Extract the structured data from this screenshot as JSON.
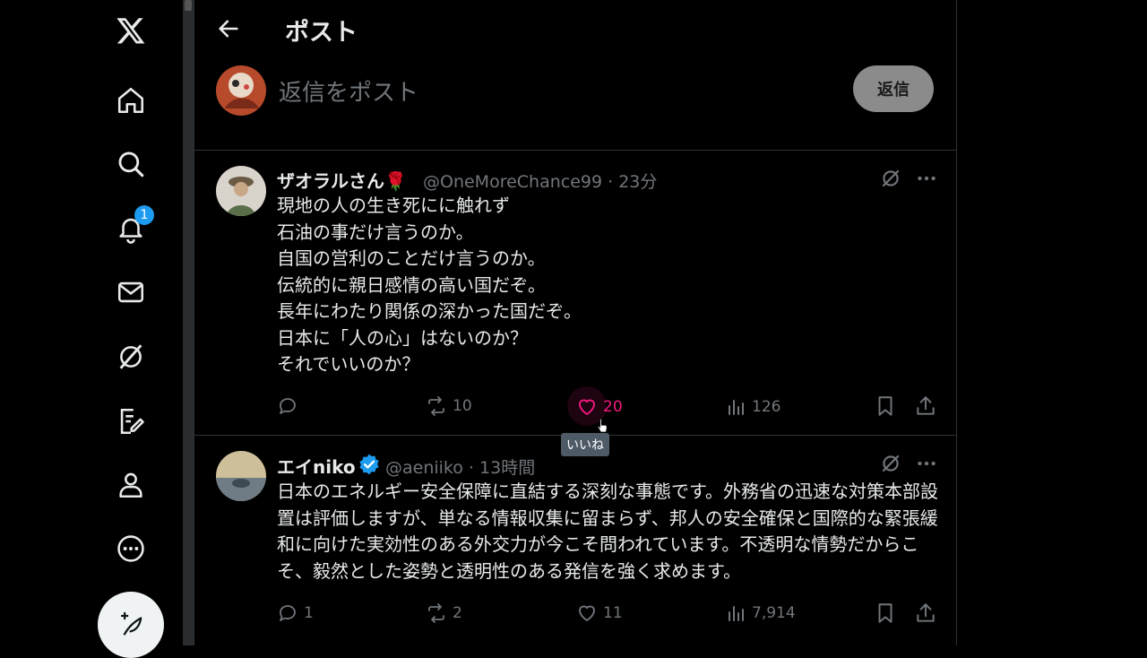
{
  "app": {
    "logo": "X"
  },
  "nav": {
    "items": [
      {
        "icon": "home-icon"
      },
      {
        "icon": "search-icon"
      },
      {
        "icon": "bell-icon",
        "badge": "1"
      },
      {
        "icon": "mail-icon"
      },
      {
        "icon": "grok-icon"
      },
      {
        "icon": "compose-note-icon"
      },
      {
        "icon": "profile-icon"
      },
      {
        "icon": "more-circle-icon"
      }
    ]
  },
  "header": {
    "title": "ポスト"
  },
  "reply": {
    "placeholder": "返信をポスト",
    "button_label": "返信"
  },
  "tweets": [
    {
      "name": "ザオラルさん🌹",
      "handle": "@OneMoreChance99",
      "time": "23分",
      "body": "現地の人の生き死にに触れず\n石油の事だけ言うのか。\n自国の営利のことだけ言うのか。\n伝統的に親日感情の高い国だぞ。\n長年にわたり関係の深かった国だぞ。\n日本に「人の心」はないのか？\nそれでいいのか？",
      "replies": "",
      "retweets": "10",
      "likes": "20",
      "views": "126",
      "liked": true,
      "tooltip": "いいね"
    },
    {
      "name": "エイniko",
      "handle": "@aeniiko",
      "time": "13時間",
      "verified": true,
      "body": "日本のエネルギー安全保障に直結する深刻な事態です。外務省の迅速な対策本部設置は評価しますが、単なる情報収集に留まらず、邦人の安全確保と国際的な緊張緩和に向けた実効性のある外交力が今こそ問われています。不透明な情勢だからこそ、毅然とした姿勢と透明性のある発信を強く求めます。",
      "replies": "1",
      "retweets": "2",
      "likes": "11",
      "views": "7,914"
    }
  ],
  "colors": {
    "accent": "#1d9bf0",
    "like": "#f91880",
    "muted": "#71767b",
    "text": "#e7e9ea"
  }
}
